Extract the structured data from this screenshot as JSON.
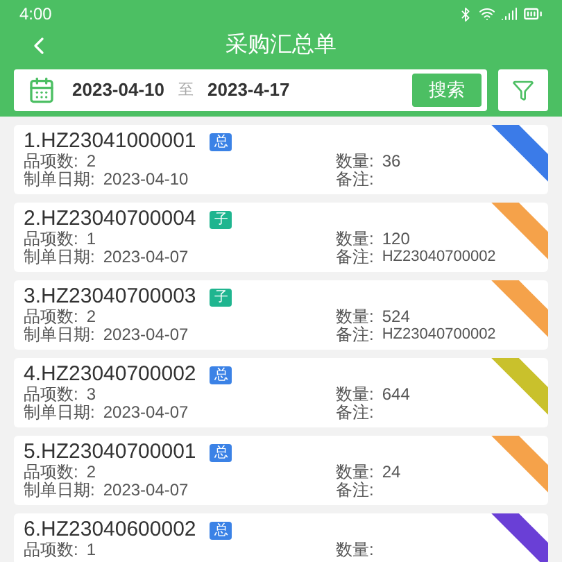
{
  "status_bar": {
    "time": "4:00"
  },
  "header": {
    "title": "采购汇总单"
  },
  "search": {
    "start_date": "2023-04-10",
    "separator": "至",
    "end_date": "2023-4-17",
    "button": "搜索"
  },
  "orders": [
    {
      "title": "1.HZ23041000001",
      "tag": {
        "label": "总",
        "color": "#3b82e6"
      },
      "items_label": "品项数:",
      "items": "2",
      "date_label": "制单日期:",
      "date": "2023-04-10",
      "qty_label": "数量:",
      "qty": "36",
      "note_label": "备注:",
      "color": "#3b7be8"
    },
    {
      "title": "2.HZ23040700004",
      "tag": {
        "label": "子",
        "color": "#1fb58f"
      },
      "items_label": "品项数:",
      "items": "1",
      "date_label": "制单日期:",
      "date": "2023-04-07",
      "qty_label": "数量:",
      "qty": "120",
      "note_label": "备注:",
      "note": "HZ23040700002",
      "color": "#f5a24a"
    },
    {
      "title": "3.HZ23040700003",
      "tag": {
        "label": "子",
        "color": "#1fb58f"
      },
      "items_label": "品项数:",
      "items": "2",
      "date_label": "制单日期:",
      "date": "2023-04-07",
      "qty_label": "数量:",
      "qty": "524",
      "note_label": "备注:",
      "note": "HZ23040700002",
      "color": "#f5a24a"
    },
    {
      "title": "4.HZ23040700002",
      "tag": {
        "label": "总",
        "color": "#3b82e6"
      },
      "items_label": "品项数:",
      "items": "3",
      "date_label": "制单日期:",
      "date": "2023-04-07",
      "qty_label": "数量:",
      "qty": "644",
      "note_label": "备注:",
      "color": "#c9c12c"
    },
    {
      "title": "5.HZ23040700001",
      "tag": {
        "label": "总",
        "color": "#3b82e6"
      },
      "items_label": "品项数:",
      "items": "2",
      "date_label": "制单日期:",
      "date": "2023-04-07",
      "qty_label": "数量:",
      "qty": "24",
      "note_label": "备注:",
      "color": "#f5a24a"
    },
    {
      "title": "6.HZ23040600002",
      "tag": {
        "label": "总",
        "color": "#3b82e6"
      },
      "items_label": "品项数:",
      "items": "1",
      "qty_label": "数量:",
      "color": "#6a3fd6"
    }
  ]
}
